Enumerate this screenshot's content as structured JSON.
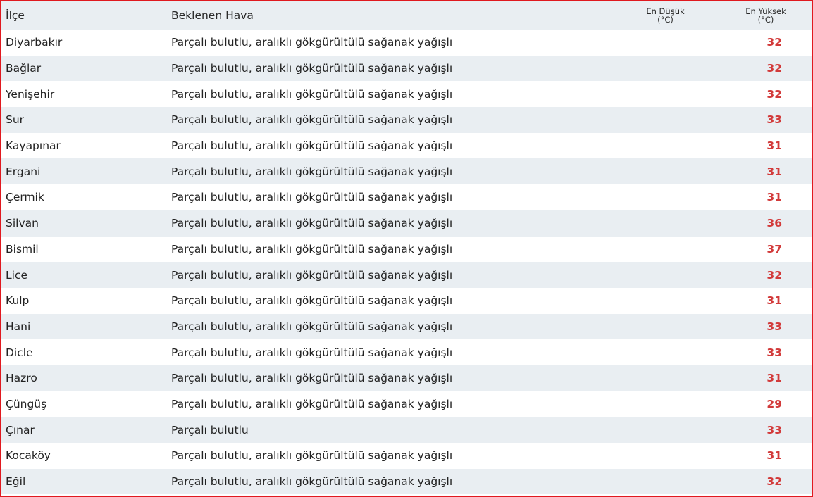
{
  "table": {
    "headers": {
      "district": "İlçe",
      "weather": "Beklenen Hava",
      "low_line1": "En Düşük",
      "low_line2": "(°C)",
      "high_line1": "En Yüksek",
      "high_line2": "(°C)"
    },
    "rows": [
      {
        "district": "Diyarbakır",
        "weather": "Parçalı bulutlu, aralıklı gökgürültülü sağanak yağışlı",
        "low": "",
        "high": "32"
      },
      {
        "district": "Bağlar",
        "weather": "Parçalı bulutlu, aralıklı gökgürültülü sağanak yağışlı",
        "low": "",
        "high": "32"
      },
      {
        "district": "Yenişehir",
        "weather": "Parçalı bulutlu, aralıklı gökgürültülü sağanak yağışlı",
        "low": "",
        "high": "32"
      },
      {
        "district": "Sur",
        "weather": "Parçalı bulutlu, aralıklı gökgürültülü sağanak yağışlı",
        "low": "",
        "high": "33"
      },
      {
        "district": "Kayapınar",
        "weather": "Parçalı bulutlu, aralıklı gökgürültülü sağanak yağışlı",
        "low": "",
        "high": "31"
      },
      {
        "district": "Ergani",
        "weather": "Parçalı bulutlu, aralıklı gökgürültülü sağanak yağışlı",
        "low": "",
        "high": "31"
      },
      {
        "district": "Çermik",
        "weather": "Parçalı bulutlu, aralıklı gökgürültülü sağanak yağışlı",
        "low": "",
        "high": "31"
      },
      {
        "district": "Silvan",
        "weather": "Parçalı bulutlu, aralıklı gökgürültülü sağanak yağışlı",
        "low": "",
        "high": "36"
      },
      {
        "district": "Bismil",
        "weather": "Parçalı bulutlu, aralıklı gökgürültülü sağanak yağışlı",
        "low": "",
        "high": "37"
      },
      {
        "district": "Lice",
        "weather": "Parçalı bulutlu, aralıklı gökgürültülü sağanak yağışlı",
        "low": "",
        "high": "32"
      },
      {
        "district": "Kulp",
        "weather": "Parçalı bulutlu, aralıklı gökgürültülü sağanak yağışlı",
        "low": "",
        "high": "31"
      },
      {
        "district": "Hani",
        "weather": "Parçalı bulutlu, aralıklı gökgürültülü sağanak yağışlı",
        "low": "",
        "high": "33"
      },
      {
        "district": "Dicle",
        "weather": "Parçalı bulutlu, aralıklı gökgürültülü sağanak yağışlı",
        "low": "",
        "high": "33"
      },
      {
        "district": "Hazro",
        "weather": "Parçalı bulutlu, aralıklı gökgürültülü sağanak yağışlı",
        "low": "",
        "high": "31"
      },
      {
        "district": "Çüngüş",
        "weather": "Parçalı bulutlu, aralıklı gökgürültülü sağanak yağışlı",
        "low": "",
        "high": "29"
      },
      {
        "district": "Çınar",
        "weather": "Parçalı bulutlu",
        "low": "",
        "high": "33"
      },
      {
        "district": "Kocaköy",
        "weather": "Parçalı bulutlu, aralıklı gökgürültülü sağanak yağışlı",
        "low": "",
        "high": "31"
      },
      {
        "district": "Eğil",
        "weather": "Parçalı bulutlu, aralıklı gökgürültülü sağanak yağışlı",
        "low": "",
        "high": "32"
      }
    ]
  },
  "colors": {
    "header_bg": "#e9eef2",
    "stripe_bg": "#e9eef2",
    "high_temp": "#d23a3a",
    "frame_border": "#e0191f"
  }
}
